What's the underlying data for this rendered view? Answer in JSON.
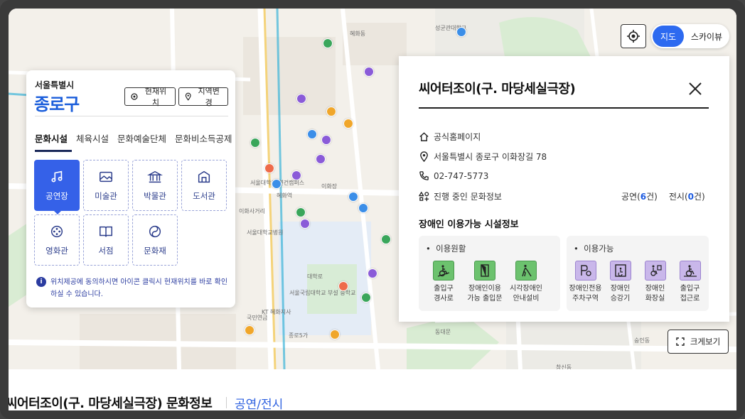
{
  "left_panel": {
    "region": "서울특별시",
    "district": "종로구",
    "current_location_label": "현재위치",
    "change_region_label": "지역변경",
    "tabs": [
      "문화시설",
      "체육시설",
      "문화예술단체",
      "문화비소득공제"
    ],
    "categories": [
      {
        "label": "공연장",
        "icon": "music-icon",
        "active": true
      },
      {
        "label": "미술관",
        "icon": "picture-icon"
      },
      {
        "label": "박물관",
        "icon": "museum-icon"
      },
      {
        "label": "도서관",
        "icon": "library-icon"
      },
      {
        "label": "영화관",
        "icon": "film-icon"
      },
      {
        "label": "서점",
        "icon": "book-icon"
      },
      {
        "label": "문화재",
        "icon": "heritage-icon"
      }
    ],
    "notice": "위치제공에 동의하시면 아이콘 클릭시 현재위치를 바로 확인하실 수 있습니다."
  },
  "map_controls": {
    "view_map": "지도",
    "view_skyview": "스카이뷰",
    "enlarge": "크게보기"
  },
  "detail": {
    "title": "씨어터조이(구. 마당세실극장)",
    "homepage": "공식홈페이지",
    "address": "서울특별시 종로구 이화장길 78",
    "phone": "02-747-5773",
    "ongoing_label": "진행 중인 문화정보",
    "performance_label": "공연(",
    "performance_count": "6",
    "performance_suffix": "건)",
    "exhibition_label": "전시(",
    "exhibition_count": "0",
    "exhibition_suffix": "건)",
    "accessibility_title": "장애인 이용가능 시설정보",
    "smooth_label": "이용원활",
    "smooth_items": [
      {
        "line1": "출입구",
        "line2": "경사로"
      },
      {
        "line1": "장애인이용",
        "line2": "가능 출입문"
      },
      {
        "line1": "시각장애인",
        "line2": "안내설비"
      }
    ],
    "available_label": "이용가능",
    "available_items": [
      {
        "line1": "장애인전용",
        "line2": "주차구역"
      },
      {
        "line1": "장애인",
        "line2": "승강기"
      },
      {
        "line1": "장애인",
        "line2": "화장실"
      },
      {
        "line1": "출입구",
        "line2": "접근로"
      }
    ]
  },
  "bottom": {
    "title": "씨어터조이(구. 마당세실극장) 문화정보",
    "tab": "공연/전시"
  },
  "map_labels": [
    "서울대학교 연건캠퍼스",
    "이화사거리",
    "혜화역",
    "대학로",
    "서울대학교병원",
    "종로5가",
    "창신동",
    "숭인동",
    "동대문",
    "혜화동",
    "서울국립대학교 부설 중학교",
    "국민연금",
    "KT 혜화지사",
    "성균관대학교",
    "이화장"
  ],
  "colors": {
    "accent": "#3561e8",
    "brand_text": "#1b5edb",
    "nav_dark": "#1c2a5a"
  }
}
